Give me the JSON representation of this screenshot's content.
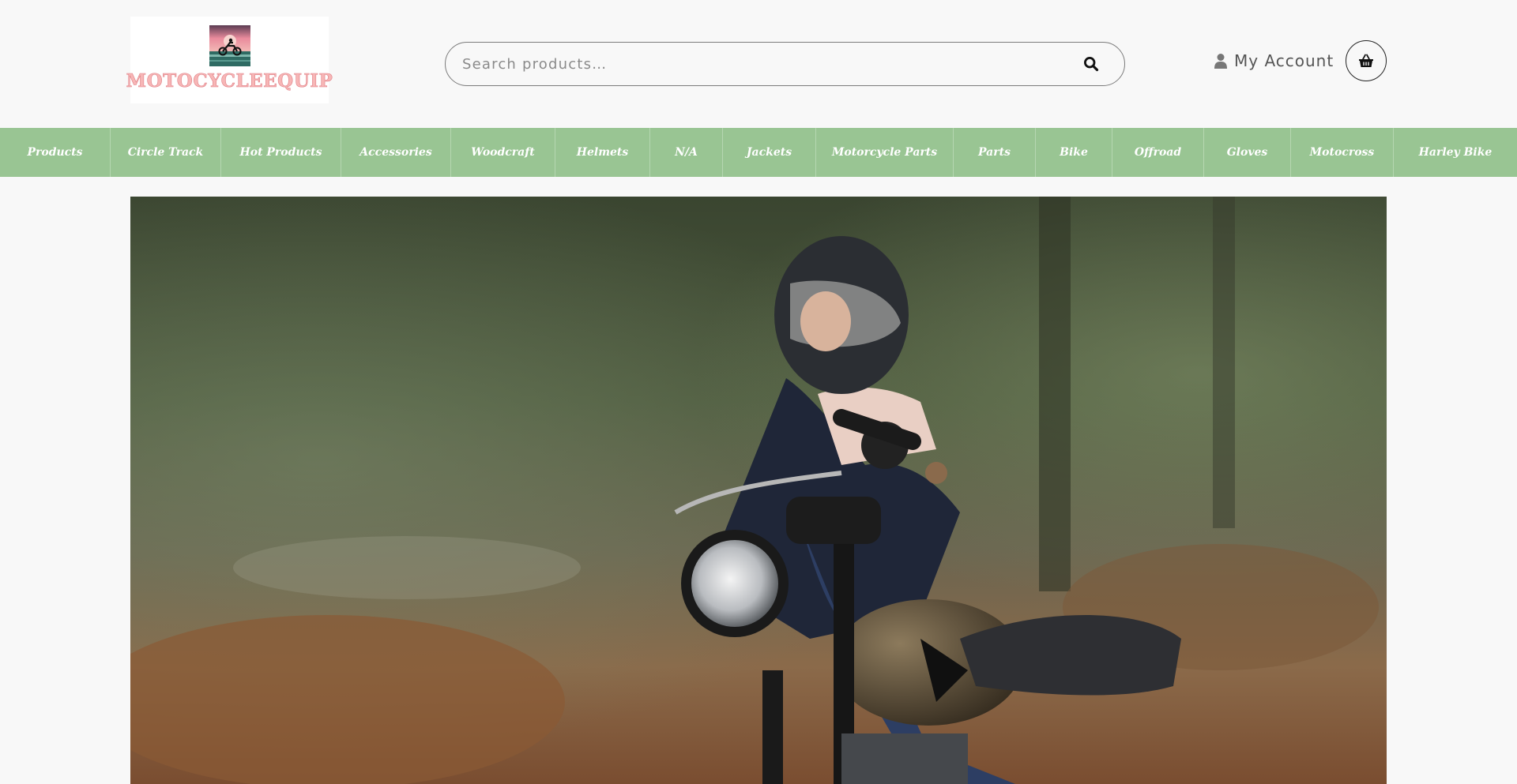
{
  "logo": {
    "text": "MOTOCYCLEEQUIP"
  },
  "search": {
    "placeholder": "Search products…",
    "icon": "search-icon"
  },
  "account": {
    "label": "My Account",
    "icon": "user-icon"
  },
  "cart": {
    "icon": "basket-icon"
  },
  "nav": {
    "items": [
      {
        "label": "Products"
      },
      {
        "label": "Circle Track"
      },
      {
        "label": "Hot Products"
      },
      {
        "label": "Accessories"
      },
      {
        "label": "Woodcraft"
      },
      {
        "label": "Helmets"
      },
      {
        "label": "N/A"
      },
      {
        "label": "Jackets"
      },
      {
        "label": "Motorcycle Parts"
      },
      {
        "label": "Parts"
      },
      {
        "label": "Bike"
      },
      {
        "label": "Offroad"
      },
      {
        "label": "Gloves"
      },
      {
        "label": "Motocross"
      },
      {
        "label": "Harley Bike"
      }
    ]
  },
  "colors": {
    "nav_bg": "#99c593",
    "logo_text": "#f7b6b6",
    "page_bg": "#f8f8f8"
  }
}
